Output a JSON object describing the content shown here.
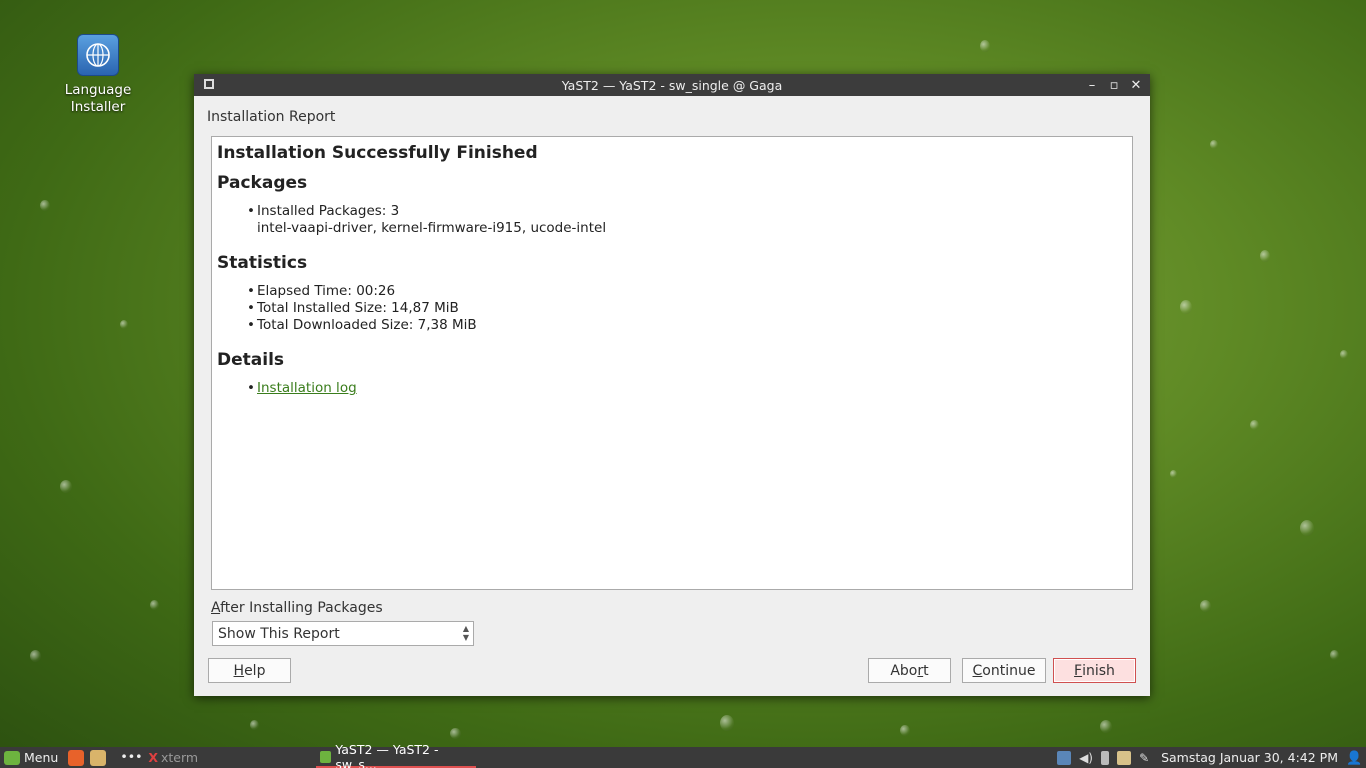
{
  "desktop": {
    "icon_label_line1": "Language",
    "icon_label_line2": "Installer"
  },
  "window": {
    "title": "YaST2 — YaST2 - sw_single @ Gaga",
    "section_title": "Installation Report",
    "report": {
      "heading": "Installation Successfully Finished",
      "packages_heading": "Packages",
      "installed_packages": "Installed Packages: 3",
      "package_list": "intel-vaapi-driver, kernel-firmware-i915, ucode-intel",
      "statistics_heading": "Statistics",
      "elapsed_time": "Elapsed Time: 00:26",
      "total_installed_size": "Total Installed Size: 14,87 MiB",
      "total_downloaded_size": "Total Downloaded Size: 7,38 MiB",
      "details_heading": "Details",
      "installation_log_link": "Installation log"
    },
    "after_installing": {
      "label_underlined": "A",
      "label_rest": "fter Installing Packages",
      "selected": "Show This Report"
    },
    "buttons": {
      "help_u": "H",
      "help_rest": "elp",
      "abort_pre": "Abo",
      "abort_u": "r",
      "abort_post": "t",
      "continue_u": "C",
      "continue_rest": "ontinue",
      "finish_u": "F",
      "finish_rest": "inish"
    }
  },
  "taskbar": {
    "menu_label": "Menu",
    "xterm_label": "xterm",
    "active_task": "YaST2 — YaST2 - sw_s...",
    "clock": "Samstag Januar 30,  4:42 PM"
  }
}
